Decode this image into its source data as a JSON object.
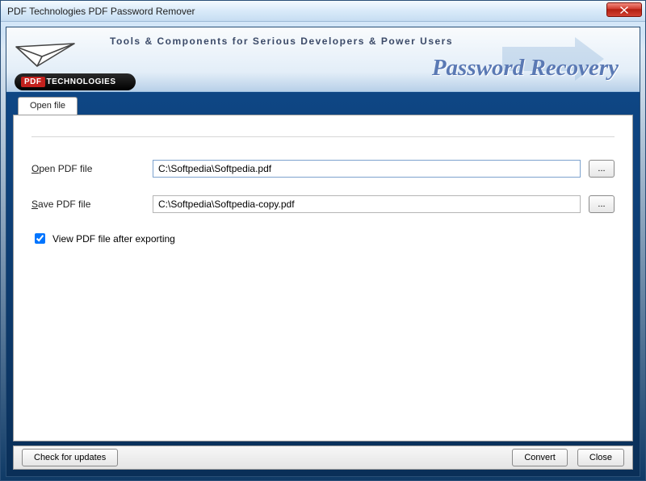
{
  "window": {
    "title": "PDF Technologies PDF Password Remover"
  },
  "banner": {
    "tagline": "Tools & Components for Serious Developers & Power Users",
    "brand_title": "Password Recovery",
    "logo_pdf": "PDF",
    "logo_rest": "TECHNOLOGIES"
  },
  "tabs": {
    "open_file": "Open file"
  },
  "form": {
    "open_label_pre": "O",
    "open_label_post": "pen PDF file",
    "open_value": "C:\\Softpedia\\Softpedia.pdf",
    "save_label_pre": "S",
    "save_label_post": "ave PDF file",
    "save_value": "C:\\Softpedia\\Softpedia-copy.pdf",
    "browse_label": "...",
    "view_after_pre": "V",
    "view_after_post": "iew PDF file after exporting",
    "view_after_checked": true
  },
  "footer": {
    "check_updates": "Check for updates",
    "convert_pre": "C",
    "convert_post": "onvert",
    "close_pre": "C",
    "close_post": "lose"
  }
}
